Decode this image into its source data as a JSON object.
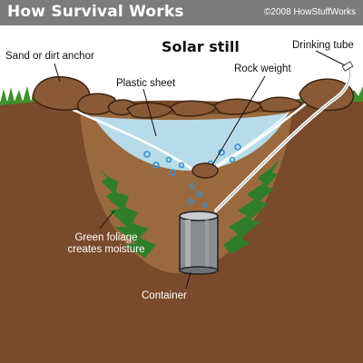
{
  "header": {
    "site_title": "How Survival Works",
    "copyright": "©2008 HowStuffWorks"
  },
  "diagram": {
    "title": "Solar still",
    "labels": {
      "sand_anchor": "Sand or dirt anchor",
      "drinking_tube": "Drinking tube",
      "plastic_sheet": "Plastic sheet",
      "rock_weight": "Rock weight",
      "green_foliage_line1": "Green foliage",
      "green_foliage_line2": "creates moisture",
      "container": "Container"
    }
  },
  "colors": {
    "banner": "#7c7c7c",
    "soil": "#7a4a2c",
    "pit": "#9a6a3e",
    "grass": "#3f8f2a",
    "water": "#b9e2f2",
    "droplet": "#3a8fd0",
    "rock": "#8a5a36",
    "container": "#8a8d90"
  }
}
